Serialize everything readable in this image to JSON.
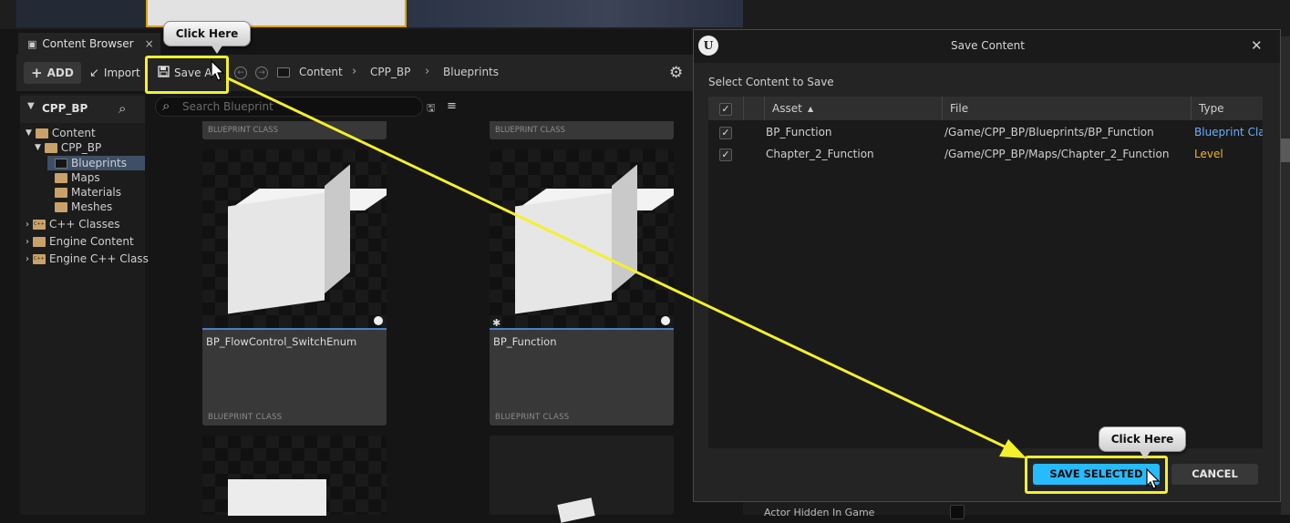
{
  "content_browser": {
    "tab_label": "Content Browser",
    "tab_close": "×",
    "toolbar": {
      "add_label": "ADD",
      "add_plus": "+",
      "import_label": "Import",
      "save_all_label": "Save All",
      "breadcrumbs": [
        "Content",
        "CPP_BP",
        "Blueprints"
      ],
      "crumb_separator": "›"
    },
    "sources": {
      "header": "CPP_BP",
      "tree": [
        {
          "label": "Content"
        },
        {
          "label": "CPP_BP"
        },
        {
          "label": "Blueprints",
          "selected": true
        },
        {
          "label": "Maps"
        },
        {
          "label": "Materials"
        },
        {
          "label": "Meshes"
        },
        {
          "label": "C++ Classes"
        },
        {
          "label": "Engine Content"
        },
        {
          "label": "Engine C++ Class"
        }
      ]
    },
    "search_placeholder": "Search Blueprints",
    "assets": [
      {
        "name": "",
        "class": "BLUEPRINT CLASS"
      },
      {
        "name": "",
        "class": "BLUEPRINT CLASS"
      },
      {
        "name": "BP_FlowControl_SwitchEnum",
        "class": "BLUEPRINT CLASS"
      },
      {
        "name": "BP_Function",
        "class": "BLUEPRINT CLASS"
      }
    ]
  },
  "dialog": {
    "title": "Save Content",
    "close": "✕",
    "subtitle": "Select Content to Save",
    "columns": {
      "asset": "Asset",
      "file": "File",
      "type": "Type",
      "sort_indicator": "▲"
    },
    "rows": [
      {
        "asset": "BP_Function",
        "file": "/Game/CPP_BP/Blueprints/BP_Function",
        "type": "Blueprint Cla",
        "type_color": "#6aaefc",
        "checked": true
      },
      {
        "asset": "Chapter_2_Function",
        "file": "/Game/CPP_BP/Maps/Chapter_2_Function",
        "type": "Level",
        "type_color": "#f0b429",
        "checked": true
      }
    ],
    "save_button": "SAVE SELECTED",
    "cancel_button": "CANCEL",
    "check_glyph": "✓"
  },
  "details_panel": {
    "row_label": "Actor Hidden In Game"
  },
  "callouts": {
    "top": "Click Here",
    "bottom": "Click Here",
    "highlight_color": "#f4f02c"
  },
  "colors": {
    "accent": "#26bbff",
    "selection": "#3d4f66",
    "panel": "#242424"
  }
}
